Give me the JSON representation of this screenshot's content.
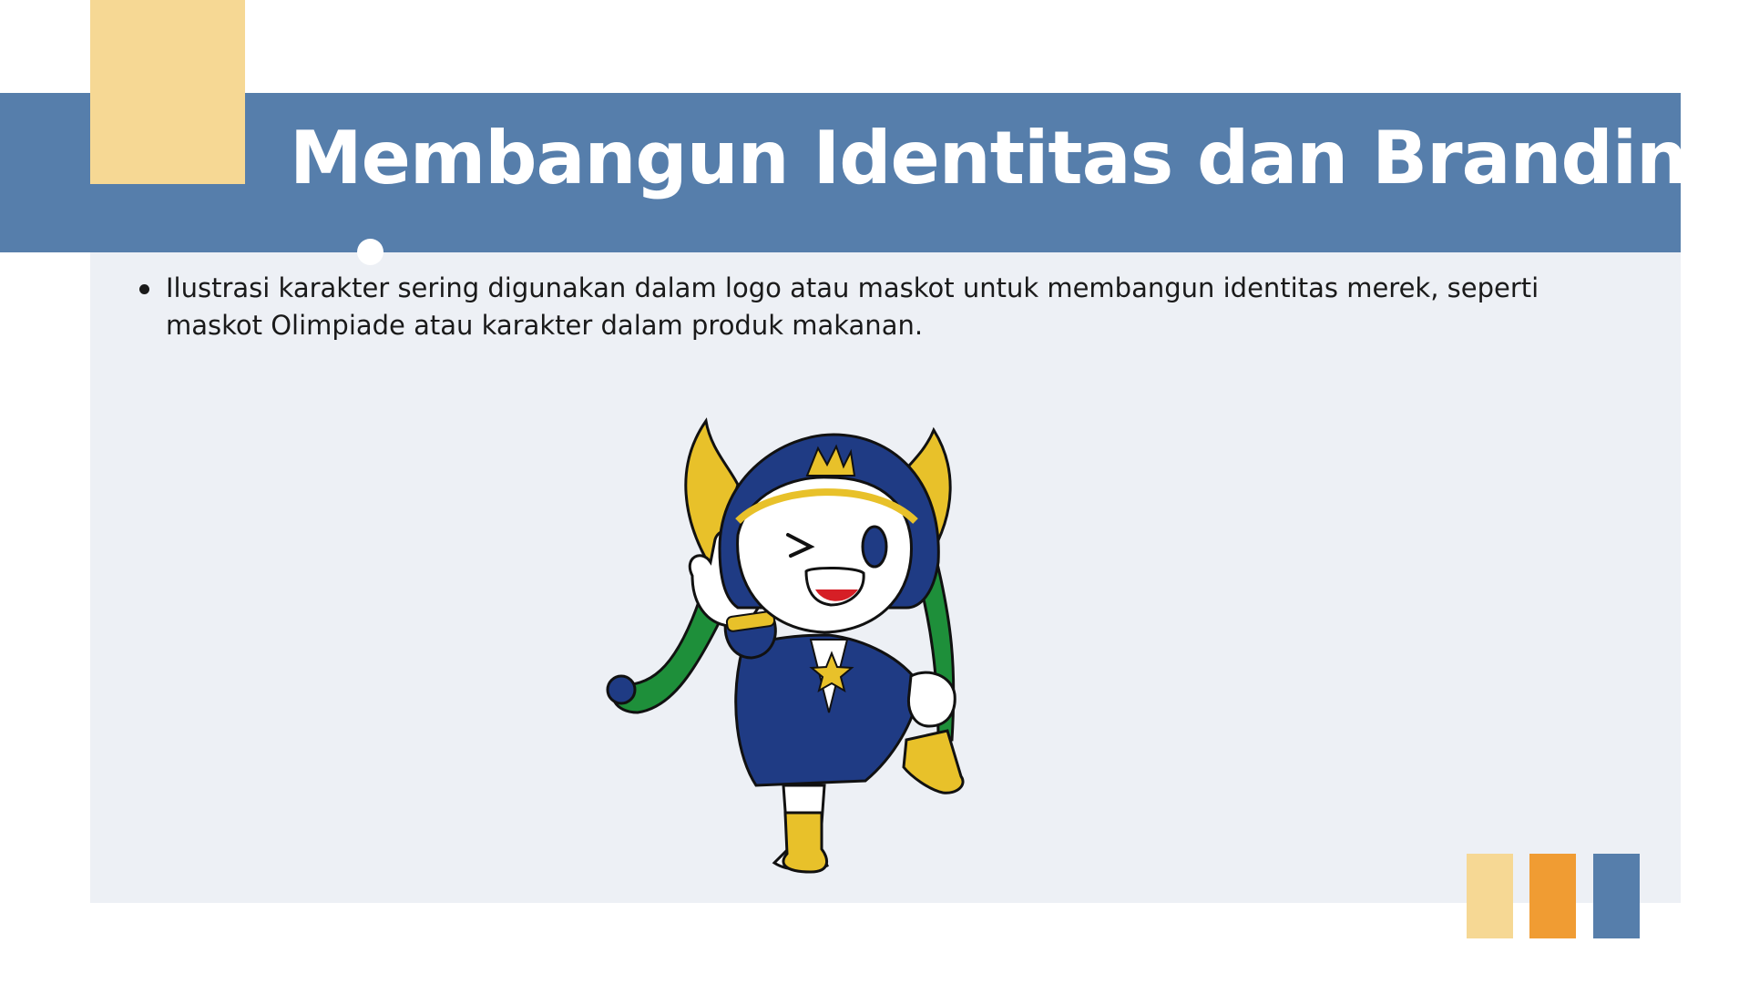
{
  "slide": {
    "title": "Membangun Identitas dan Branding",
    "bullets": [
      "Ilustrasi karakter sering digunakan dalam logo atau maskot untuk membangun identitas merek, seperti maskot Olimpiade atau karakter dalam produk makanan."
    ],
    "mascot_icon": "mascot-illustration"
  },
  "colors": {
    "band": "#567eab",
    "panel": "#edf0f5",
    "yellow": "#f6d894",
    "orange": "#f09c33",
    "blue": "#567eab",
    "mascot_navy": "#1f3b84",
    "mascot_gold": "#e8c12a",
    "mascot_green": "#1e8f3a"
  },
  "swatches": [
    "#f6d894",
    "#f09c33",
    "#567eab"
  ]
}
